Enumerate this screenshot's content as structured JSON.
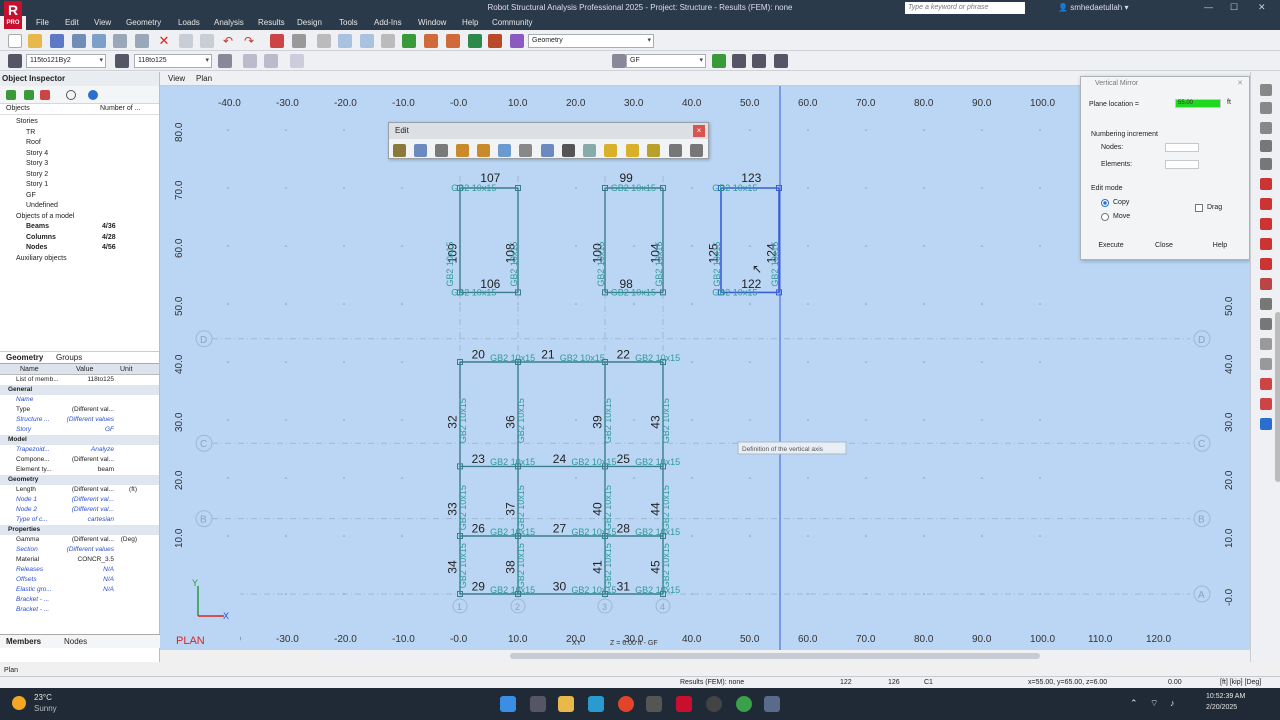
{
  "app": {
    "logo_letter": "R",
    "logo_sub": "PRO",
    "title": "Robot Structural Analysis Professional 2025 - Project: Structure - Results (FEM): none",
    "search_placeholder": "Type a keyword or phrase",
    "user": "smhedaetullah",
    "window_buttons": [
      "—",
      "☐",
      "✕"
    ]
  },
  "menu": [
    "File",
    "Edit",
    "View",
    "Geometry",
    "Loads",
    "Analysis",
    "Results",
    "Design",
    "Tools",
    "Add-Ins",
    "Window",
    "Help",
    "Community"
  ],
  "toolbar": {
    "layout_combo": "Geometry",
    "selection_combo": "115to121By2",
    "selection_combo2": "118to125",
    "story_combo": "GF"
  },
  "object_inspector": {
    "title": "Object Inspector",
    "col_objects": "Objects",
    "col_number": "Number of ...",
    "tree": [
      {
        "label": "Stories",
        "indent": 1,
        "count": ""
      },
      {
        "label": "TR",
        "indent": 2,
        "count": ""
      },
      {
        "label": "Roof",
        "indent": 2,
        "count": ""
      },
      {
        "label": "Story 4",
        "indent": 2,
        "count": ""
      },
      {
        "label": "Story 3",
        "indent": 2,
        "count": ""
      },
      {
        "label": "Story 2",
        "indent": 2,
        "count": ""
      },
      {
        "label": "Story 1",
        "indent": 2,
        "count": ""
      },
      {
        "label": "GF",
        "indent": 2,
        "count": ""
      },
      {
        "label": "Undefined",
        "indent": 2,
        "count": ""
      },
      {
        "label": "Objects of a model",
        "indent": 1,
        "count": ""
      },
      {
        "label": "Beams",
        "indent": 2,
        "count": "4/36",
        "bold": true
      },
      {
        "label": "Columns",
        "indent": 2,
        "count": "4/28",
        "bold": true
      },
      {
        "label": "Nodes",
        "indent": 2,
        "count": "4/56",
        "bold": true
      },
      {
        "label": "Auxiliary objects",
        "indent": 1,
        "count": ""
      }
    ],
    "tab_geometry": "Geometry",
    "tab_groups": "Groups",
    "prop_headers": {
      "name": "Name",
      "value": "Value",
      "unit": "Unit"
    },
    "props": [
      {
        "n": "List of memb...",
        "v": "118to125",
        "u": "",
        "t": ""
      },
      {
        "n": "General",
        "v": "",
        "u": "",
        "t": "sec"
      },
      {
        "n": "Name",
        "v": "",
        "u": "",
        "t": "blue"
      },
      {
        "n": "Type",
        "v": "(Different val...",
        "u": "",
        "t": ""
      },
      {
        "n": "Structure ...",
        "v": "(Different values",
        "u": "",
        "t": "blue"
      },
      {
        "n": "Story",
        "v": "GF",
        "u": "",
        "t": "blue"
      },
      {
        "n": "Model",
        "v": "",
        "u": "",
        "t": "sec"
      },
      {
        "n": "Trapezoid...",
        "v": "Analyze",
        "u": "",
        "t": "blue"
      },
      {
        "n": "Compone...",
        "v": "(Different val...",
        "u": "",
        "t": ""
      },
      {
        "n": "Element ty...",
        "v": "beam",
        "u": "",
        "t": ""
      },
      {
        "n": "Geometry",
        "v": "",
        "u": "",
        "t": "sec"
      },
      {
        "n": "Length",
        "v": "(Different val...",
        "u": "(ft)",
        "t": ""
      },
      {
        "n": "Node 1",
        "v": "(Different val...",
        "u": "",
        "t": "blue"
      },
      {
        "n": "Node 2",
        "v": "(Different val...",
        "u": "",
        "t": "blue"
      },
      {
        "n": "Type of c...",
        "v": "cartesian",
        "u": "",
        "t": "blue"
      },
      {
        "n": "Properties",
        "v": "",
        "u": "",
        "t": "sec"
      },
      {
        "n": "Gamma",
        "v": "(Different val...",
        "u": "(Deg)",
        "t": ""
      },
      {
        "n": "Section",
        "v": "(Different values",
        "u": "",
        "t": "blue"
      },
      {
        "n": "Material",
        "v": "CONCR_3.5",
        "u": "",
        "t": ""
      },
      {
        "n": "Releases",
        "v": "N/A",
        "u": "",
        "t": "blue"
      },
      {
        "n": "Offsets",
        "v": "N/A",
        "u": "",
        "t": "blue"
      },
      {
        "n": "Elastic gro...",
        "v": "N/A",
        "u": "",
        "t": "blue"
      },
      {
        "n": "Bracket - ...",
        "v": "",
        "u": "",
        "t": "blue"
      },
      {
        "n": "Bracket - ...",
        "v": "",
        "u": "",
        "t": "blue"
      }
    ],
    "bottom_tab_members": "Members",
    "bottom_tab_nodes": "Nodes"
  },
  "view_tabs": {
    "view": "View",
    "plan": "Plan"
  },
  "edit_toolbar": {
    "title": "Edit",
    "close": "×"
  },
  "vertical_mirror": {
    "title": "Vertical Mirror",
    "plane_location_label": "Plane location =",
    "plane_location_value": "55.00",
    "plane_unit": "ft",
    "numbering_label": "Numbering increment",
    "nodes_label": "Nodes:",
    "elements_label": "Elements:",
    "edit_mode_label": "Edit mode",
    "copy_label": "Copy",
    "move_label": "Move",
    "drag_label": "Drag",
    "execute": "Execute",
    "close": "Close",
    "help": "Help"
  },
  "canvas": {
    "x_ticks": [
      "-40.0",
      "-30.0",
      "-20.0",
      "-10.0",
      "-0.0",
      "10.0",
      "20.0",
      "30.0",
      "40.0",
      "50.0",
      "60.0",
      "70.0",
      "80.0",
      "90.0",
      "100.0"
    ],
    "x_ticks_bottom": [
      "-40.0",
      "-30.0",
      "-20.0",
      "-10.0",
      "-0.0",
      "10.0",
      "20.0",
      "30.0",
      "40.0",
      "50.0",
      "60.0",
      "70.0",
      "80.0",
      "90.0",
      "100.0",
      "110.0",
      "120.0"
    ],
    "y_ticks": [
      "80.0",
      "70.0",
      "60.0",
      "50.0",
      "40.0",
      "30.0",
      "20.0",
      "10.0",
      "-0.0"
    ],
    "axis_letters": [
      "D",
      "C",
      "B",
      "A"
    ],
    "axis_numbers": [
      "1",
      "2",
      "3",
      "4"
    ],
    "plan_label": "PLAN",
    "tooltip": "Definition of the vertical axis",
    "coord_xy": "XY",
    "coord_z": "Z = 6.00 ft - GF",
    "section_label": "GB2 10x15",
    "beam_numbers_top": [
      "107",
      "99",
      "123",
      "106",
      "98",
      "122"
    ],
    "col_numbers_top": [
      "109",
      "108",
      "100",
      "104",
      "125",
      "124"
    ],
    "beam_numbers_mid": [
      "20",
      "21",
      "22",
      "23",
      "24",
      "25",
      "26",
      "27",
      "28",
      "29",
      "30",
      "31"
    ],
    "col_numbers_mid": [
      "32",
      "36",
      "39",
      "43",
      "33",
      "37",
      "40",
      "44",
      "34",
      "38",
      "41",
      "45"
    ]
  },
  "status": {
    "left": "Plan",
    "results": "Results (FEM): none",
    "n1": "122",
    "n2": "126",
    "c1": "C1",
    "coords": "x=55.00, y=65.00, z=6.00",
    "zero": "0.00",
    "units": "[ft] [kip] [Deg]"
  },
  "taskbar": {
    "temp": "23°C",
    "weather": "Sunny",
    "time": "10:52:39 AM",
    "date": "2/20/2025"
  }
}
